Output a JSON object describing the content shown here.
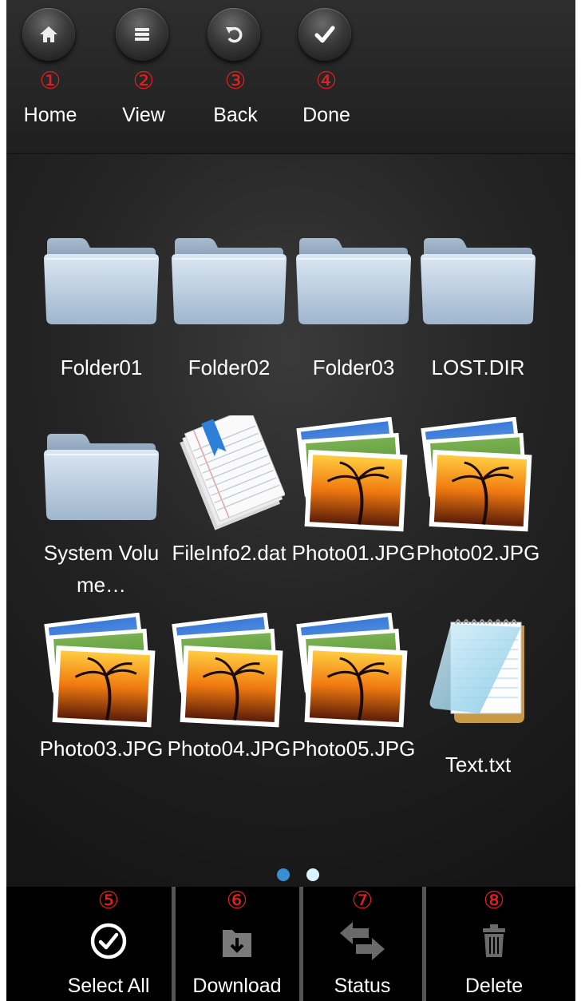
{
  "toolbar": {
    "items": [
      {
        "number": "①",
        "label": "Home",
        "icon": "home-icon"
      },
      {
        "number": "②",
        "label": "View",
        "icon": "list-icon"
      },
      {
        "number": "③",
        "label": "Back",
        "icon": "back-icon"
      },
      {
        "number": "④",
        "label": "Done",
        "icon": "check-icon"
      }
    ]
  },
  "files": [
    {
      "name": "Folder01",
      "type": "folder"
    },
    {
      "name": "Folder02",
      "type": "folder"
    },
    {
      "name": "Folder03",
      "type": "folder"
    },
    {
      "name": "LOST.DIR",
      "type": "folder"
    },
    {
      "name": "System Volume…",
      "type": "folder"
    },
    {
      "name": "FileInfo2.dat",
      "type": "document"
    },
    {
      "name": "Photo01.JPG",
      "type": "photo"
    },
    {
      "name": "Photo02.JPG",
      "type": "photo"
    },
    {
      "name": "Photo03.JPG",
      "type": "photo"
    },
    {
      "name": "Photo04.JPG",
      "type": "photo"
    },
    {
      "name": "Photo05.JPG",
      "type": "photo"
    },
    {
      "name": "Text.txt",
      "type": "text"
    }
  ],
  "pager": {
    "pages": 2,
    "current_page": 2
  },
  "bottom_bar": {
    "items": [
      {
        "number": "⑤",
        "label": "Select All",
        "icon": "select-all-icon"
      },
      {
        "number": "⑥",
        "label": "Download",
        "icon": "download-icon"
      },
      {
        "number": "⑦",
        "label": "Status",
        "icon": "status-icon"
      },
      {
        "number": "⑧",
        "label": "Delete",
        "icon": "trash-icon"
      }
    ]
  },
  "colors": {
    "annotation": "#e02020",
    "dot_active": "#d8f4ff",
    "dot_inactive": "#3a8fd0"
  }
}
